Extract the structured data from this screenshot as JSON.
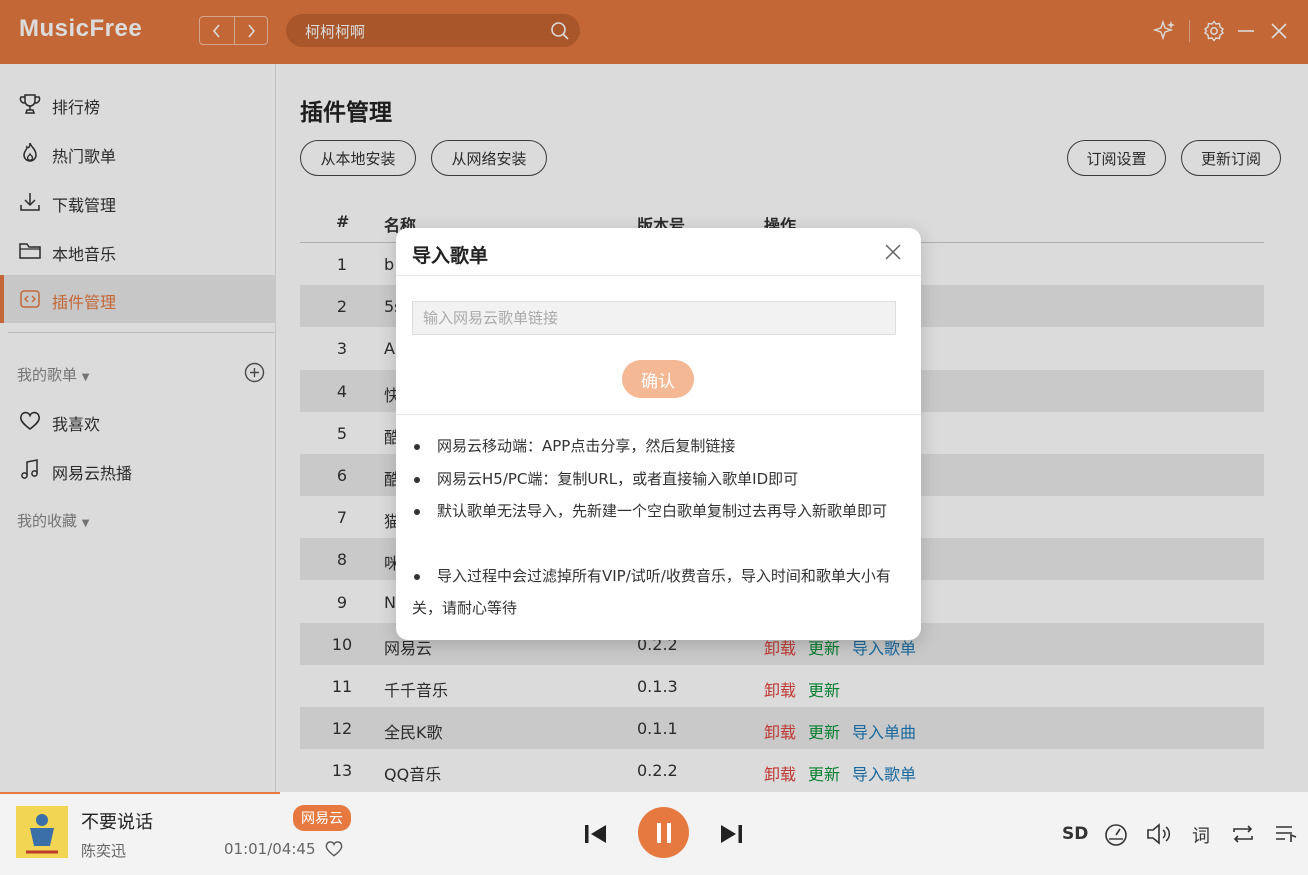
{
  "app": {
    "name": "MusicFree",
    "search_value": "柯柯柯啊"
  },
  "header_icons": [
    "back-icon",
    "forward-icon",
    "search-icon",
    "sparkle-icon",
    "gear-icon",
    "minimize-icon",
    "close-icon"
  ],
  "sidebar": {
    "items": [
      {
        "label": "排行榜",
        "icon": "trophy-icon"
      },
      {
        "label": "热门歌单",
        "icon": "fire-icon"
      },
      {
        "label": "下载管理",
        "icon": "download-icon"
      },
      {
        "label": "本地音乐",
        "icon": "folder-icon"
      },
      {
        "label": "插件管理",
        "icon": "plugin-icon",
        "active": true
      }
    ],
    "my_playlists_label": "我的歌单",
    "playlists": [
      {
        "label": "我喜欢",
        "icon": "heart-icon"
      },
      {
        "label": "网易云热播",
        "icon": "music-note-icon"
      }
    ],
    "my_collections_label": "我的收藏"
  },
  "main": {
    "title": "插件管理",
    "buttons": {
      "install_local": "从本地安装",
      "install_network": "从网络安装",
      "subscribe_settings": "订阅设置",
      "update_subscription": "更新订阅"
    },
    "table": {
      "headers": {
        "index": "#",
        "name": "名称",
        "version": "版本号",
        "actions": "操作"
      },
      "rows": [
        {
          "index": "1",
          "name": "b",
          "version": "",
          "ops": []
        },
        {
          "index": "2",
          "name": "5s",
          "version": "",
          "ops": []
        },
        {
          "index": "3",
          "name": "A",
          "version": "",
          "ops": []
        },
        {
          "index": "4",
          "name": "快",
          "version": "",
          "ops": []
        },
        {
          "index": "5",
          "name": "酷",
          "version": "",
          "ops": []
        },
        {
          "index": "6",
          "name": "酷",
          "version": "",
          "ops": []
        },
        {
          "index": "7",
          "name": "猫",
          "version": "",
          "ops": []
        },
        {
          "index": "8",
          "name": "咪",
          "version": "",
          "ops": []
        },
        {
          "index": "9",
          "name": "N",
          "version": "",
          "ops": []
        },
        {
          "index": "10",
          "name": "网易云",
          "version": "0.2.2",
          "ops": [
            "卸载",
            "更新",
            "导入歌单"
          ]
        },
        {
          "index": "11",
          "name": "千千音乐",
          "version": "0.1.3",
          "ops": [
            "卸载",
            "更新"
          ]
        },
        {
          "index": "12",
          "name": "全民K歌",
          "version": "0.1.1",
          "ops": [
            "卸载",
            "更新",
            "导入单曲"
          ]
        },
        {
          "index": "13",
          "name": "QQ音乐",
          "version": "0.2.2",
          "ops": [
            "卸载",
            "更新",
            "导入歌单"
          ]
        }
      ]
    }
  },
  "modal": {
    "title": "导入歌单",
    "input_placeholder": "输入网易云歌单链接",
    "confirm_label": "确认",
    "tips": [
      "网易云移动端：APP点击分享，然后复制链接",
      "网易云H5/PC端：复制URL，或者直接输入歌单ID即可",
      "默认歌单无法导入，先新建一个空白歌单复制过去再导入新歌单即可",
      "导入过程中会过滤掉所有VIP/试听/收费音乐，导入时间和歌单大小有关，请耐心等待"
    ]
  },
  "player": {
    "title": "不要说话",
    "artist": "陈奕迅",
    "time": "01:01/04:45",
    "source": "网易云",
    "quality": "SD",
    "lyric": "词",
    "progress": 0.214
  },
  "colors": {
    "accent": "#e5793f",
    "uninstall": "#e0443e",
    "update": "#08953a",
    "import": "#1c7ab8"
  }
}
